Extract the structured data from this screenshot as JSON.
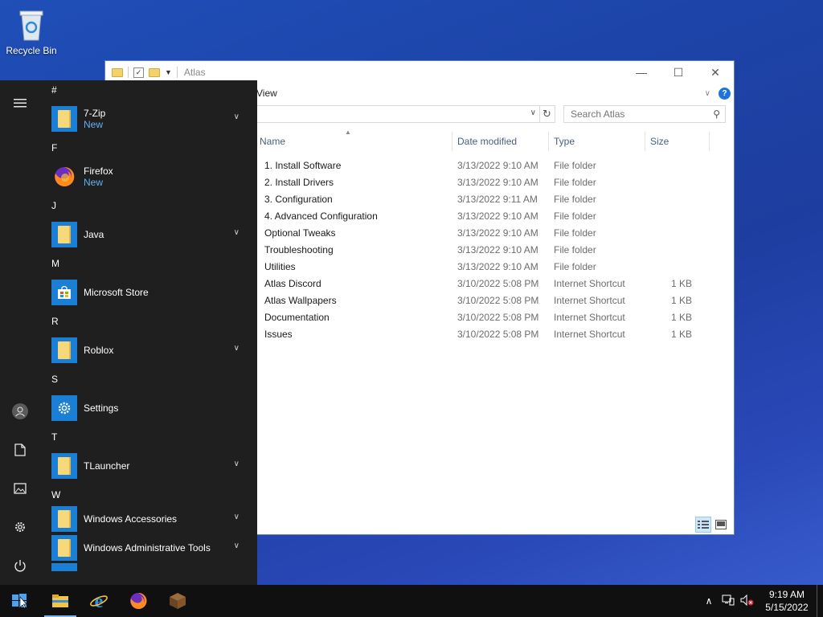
{
  "desktop": {
    "recycle_bin_label": "Recycle Bin"
  },
  "explorer": {
    "title": "Atlas",
    "ribbon_tab": "View",
    "search_placeholder": "Search Atlas",
    "columns": {
      "name": "Name",
      "date": "Date modified",
      "type": "Type",
      "size": "Size"
    },
    "rows": [
      {
        "name": "1. Install Software",
        "date": "3/13/2022 9:10 AM",
        "type": "File folder",
        "size": ""
      },
      {
        "name": "2. Install Drivers",
        "date": "3/13/2022 9:10 AM",
        "type": "File folder",
        "size": ""
      },
      {
        "name": "3. Configuration",
        "date": "3/13/2022 9:11 AM",
        "type": "File folder",
        "size": ""
      },
      {
        "name": "4. Advanced Configuration",
        "date": "3/13/2022 9:10 AM",
        "type": "File folder",
        "size": ""
      },
      {
        "name": "Optional Tweaks",
        "date": "3/13/2022 9:10 AM",
        "type": "File folder",
        "size": ""
      },
      {
        "name": "Troubleshooting",
        "date": "3/13/2022 9:10 AM",
        "type": "File folder",
        "size": ""
      },
      {
        "name": "Utilities",
        "date": "3/13/2022 9:10 AM",
        "type": "File folder",
        "size": ""
      },
      {
        "name": "Atlas Discord",
        "date": "3/10/2022 5:08 PM",
        "type": "Internet Shortcut",
        "size": "1 KB"
      },
      {
        "name": "Atlas Wallpapers",
        "date": "3/10/2022 5:08 PM",
        "type": "Internet Shortcut",
        "size": "1 KB"
      },
      {
        "name": "Documentation",
        "date": "3/10/2022 5:08 PM",
        "type": "Internet Shortcut",
        "size": "1 KB"
      },
      {
        "name": "Issues",
        "date": "3/10/2022 5:08 PM",
        "type": "Internet Shortcut",
        "size": "1 KB"
      }
    ]
  },
  "start_menu": {
    "sections": [
      {
        "letter": "#",
        "apps": [
          {
            "name": "7-Zip",
            "sub": "New",
            "icon": "folder-icon",
            "expandable": true
          }
        ]
      },
      {
        "letter": "F",
        "apps": [
          {
            "name": "Firefox",
            "sub": "New",
            "icon": "firefox-icon",
            "expandable": false
          }
        ]
      },
      {
        "letter": "J",
        "apps": [
          {
            "name": "Java",
            "sub": "",
            "icon": "folder-icon",
            "expandable": true
          }
        ]
      },
      {
        "letter": "M",
        "apps": [
          {
            "name": "Microsoft Store",
            "sub": "",
            "icon": "store-icon",
            "expandable": false
          }
        ]
      },
      {
        "letter": "R",
        "apps": [
          {
            "name": "Roblox",
            "sub": "",
            "icon": "folder-icon",
            "expandable": true
          }
        ]
      },
      {
        "letter": "S",
        "apps": [
          {
            "name": "Settings",
            "sub": "",
            "icon": "gear-icon",
            "expandable": false
          }
        ]
      },
      {
        "letter": "T",
        "apps": [
          {
            "name": "TLauncher",
            "sub": "",
            "icon": "folder-icon",
            "expandable": true
          }
        ]
      },
      {
        "letter": "W",
        "apps": [
          {
            "name": "Windows Accessories",
            "sub": "",
            "icon": "folder-icon",
            "expandable": true
          },
          {
            "name": "Windows Administrative Tools",
            "sub": "",
            "icon": "folder-icon",
            "expandable": true
          }
        ]
      }
    ]
  },
  "taskbar": {
    "time": "9:19 AM",
    "date": "5/15/2022"
  },
  "colors": {
    "accent": "#1c7fd6",
    "start_bg": "#1f1f1f",
    "taskbar_bg": "#101010"
  }
}
